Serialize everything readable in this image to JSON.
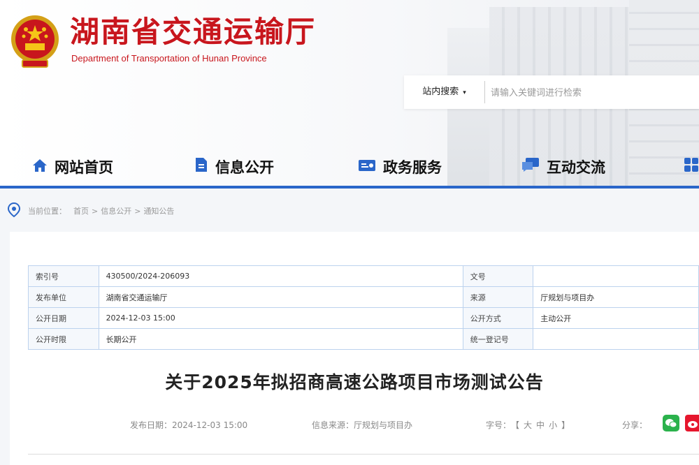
{
  "header": {
    "title": "湖南省交通运输厅",
    "subtitle": "Department of Transportation of Hunan Province",
    "emblem_icon": "national-emblem-icon",
    "brand_color": "#c8161d"
  },
  "search": {
    "scope_label": "站内搜索",
    "placeholder": "请输入关键词进行检索"
  },
  "nav": {
    "accent_color": "#2a66c9",
    "items": [
      {
        "label": "网站首页",
        "icon": "home-icon"
      },
      {
        "label": "信息公开",
        "icon": "document-icon"
      },
      {
        "label": "政务服务",
        "icon": "service-icon"
      },
      {
        "label": "互动交流",
        "icon": "chat-icon"
      }
    ]
  },
  "breadcrumb": {
    "prefix": "当前位置：",
    "items": [
      "首页",
      "信息公开",
      "通知公告"
    ],
    "separator": ">"
  },
  "meta_table": {
    "rows": [
      {
        "k1": "索引号",
        "v1": "430500/2024-206093",
        "k2": "文号",
        "v2": ""
      },
      {
        "k1": "发布单位",
        "v1": "湖南省交通运输厅",
        "k2": "来源",
        "v2": "厅规划与项目办"
      },
      {
        "k1": "公开日期",
        "v1": "2024-12-03 15:00",
        "k2": "公开方式",
        "v2": "主动公开"
      },
      {
        "k1": "公开时限",
        "v1": "长期公开",
        "k2": "统一登记号",
        "v2": ""
      }
    ]
  },
  "article": {
    "title": "关于2025年拟招商高速公路项目市场测试公告",
    "date_label": "发布日期：",
    "date": "2024-12-03 15:00",
    "source_label": "信息来源：",
    "source": "厅规划与项目办",
    "font_label": "字号：",
    "font_open": "【",
    "font_large": "大",
    "font_medium": "中",
    "font_small": "小",
    "font_close": "】",
    "share_label": "分享："
  }
}
